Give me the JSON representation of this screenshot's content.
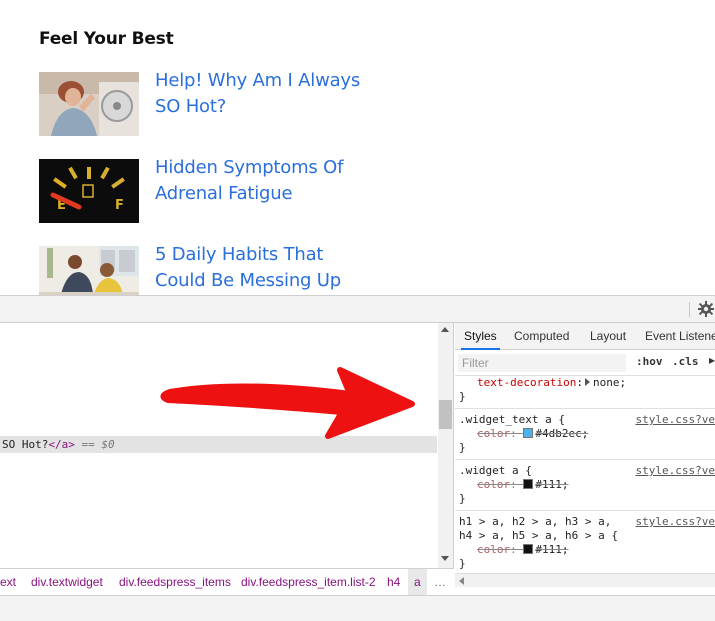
{
  "widget": {
    "title": "Feel Your Best",
    "items": [
      {
        "title": "Help! Why Am I Always SO Hot?"
      },
      {
        "title": "Hidden Symptoms Of Adrenal Fatigue"
      },
      {
        "title": "5 Daily Habits That Could Be Messing Up"
      }
    ]
  },
  "devtools": {
    "elements": {
      "selected_text": "SO Hot?",
      "selected_close_tag": "</a>",
      "selected_marker": "== $0"
    },
    "breadcrumb": [
      "ext",
      "div.textwidget",
      "div.feedspress_items",
      "div.feedspress_item.list-2",
      "h4",
      "a",
      "…"
    ],
    "tabs": [
      "Styles",
      "Computed",
      "Layout",
      "Event Listene"
    ],
    "filter_placeholder": "Filter",
    "hov_label": ":hov",
    "cls_label": ".cls",
    "rules": [
      {
        "selector": "",
        "source": "",
        "decls": [
          {
            "prop": "text-decoration",
            "val": "none;",
            "struck": false,
            "triangle": true
          }
        ]
      },
      {
        "selector": ".widget_text a {",
        "source": "style.css?ve",
        "decls": [
          {
            "prop": "color",
            "val": "#4db2ec;",
            "struck": true,
            "swatch": "#4db2ec"
          }
        ]
      },
      {
        "selector": ".widget a {",
        "source": "style.css?ve",
        "decls": [
          {
            "prop": "color",
            "val": "#111;",
            "struck": true,
            "swatch": "#111111"
          }
        ]
      },
      {
        "selector": "h1 > a, h2 > a, h3 > a,\nh4 > a, h5 > a, h6 > a {",
        "source": "style.css?ve",
        "decls": [
          {
            "prop": "color",
            "val": "#111;",
            "struck": true,
            "swatch": "#111111"
          }
        ]
      }
    ]
  },
  "colors": {
    "link": "#2a6fdb",
    "annotation_arrow": "#ee1111",
    "tag": "#881280"
  }
}
